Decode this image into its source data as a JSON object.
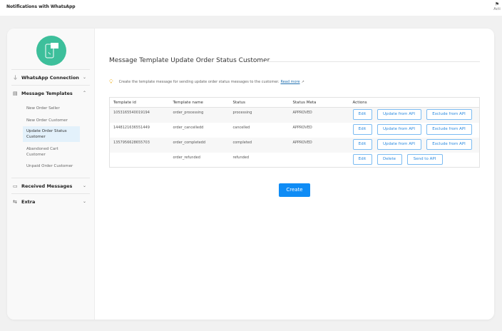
{
  "app": {
    "title": "Notifications with WhatsApp",
    "activity_label": "Acti"
  },
  "sidebar": {
    "sections": [
      {
        "label": "WhatsApp Connection",
        "icon": "plug-icon",
        "expanded": false
      },
      {
        "label": "Message Templates",
        "icon": "template-icon",
        "expanded": true,
        "items": [
          "New Order Seller",
          "New Order Customer",
          "Update Order Status Customer",
          "Abandoned Cart Customer",
          "Unpaid Order Customer"
        ]
      },
      {
        "label": "Received Messages",
        "icon": "message-icon",
        "expanded": false
      },
      {
        "label": "Extra",
        "icon": "sliders-icon",
        "expanded": false
      }
    ],
    "active_item": "Update Order Status Customer"
  },
  "main": {
    "title": "Message Template Update Order Status Customer",
    "hint": "Create the template message for sending update order status messages to the customer.",
    "read_more": "Read more",
    "columns": [
      "Template id",
      "Template name",
      "Status",
      "Status Meta",
      "Actions"
    ],
    "rows": [
      {
        "id": "1053165540019194",
        "name": "order_processing",
        "status": "processing",
        "meta": "APPROVED",
        "actions": [
          "Edit",
          "Update from API",
          "Exclude from API"
        ]
      },
      {
        "id": "1448121636551449",
        "name": "order_cancelledd",
        "status": "cancelled",
        "meta": "APPROVED",
        "actions": [
          "Edit",
          "Update from API",
          "Exclude from API"
        ]
      },
      {
        "id": "1357956628655703",
        "name": "order_completedd",
        "status": "completed",
        "meta": "APPROVED",
        "actions": [
          "Edit",
          "Update from API",
          "Exclude from API"
        ]
      },
      {
        "id": "",
        "name": "order_refunded",
        "status": "refunded",
        "meta": "",
        "actions": [
          "Edit",
          "Delete",
          "Send to API"
        ]
      }
    ],
    "create_label": "Create"
  },
  "colors": {
    "accent": "#0f8cf5",
    "logo": "#3dbf9b"
  }
}
